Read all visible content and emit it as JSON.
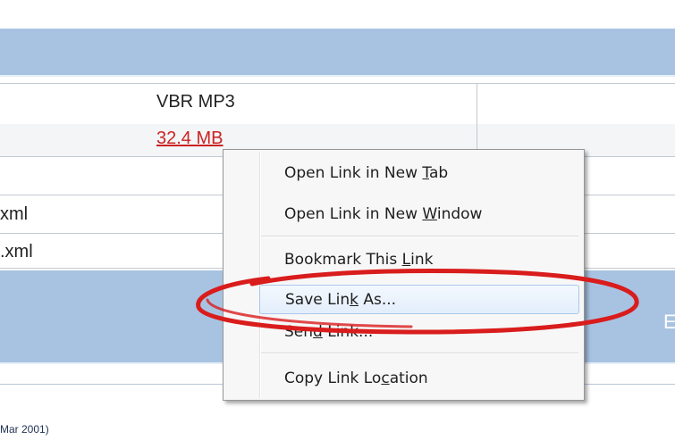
{
  "table": {
    "format_value": "VBR MP3",
    "size_value": "32.4 MB",
    "xml_row_1": "xml",
    "xml_row_2": ".xml",
    "section_char": "E",
    "footer_text": "Mar 2001)"
  },
  "context_menu": {
    "items": [
      {
        "id": "open-tab",
        "label_pre": "Open Link in New ",
        "access_key": "T",
        "label_post": "ab"
      },
      {
        "id": "open-window",
        "label_pre": "Open Link in New ",
        "access_key": "W",
        "label_post": "indow"
      },
      {
        "id": "bookmark",
        "label_pre": "Bookmark This ",
        "access_key": "L",
        "label_post": "ink"
      },
      {
        "id": "save-as",
        "label_pre": "Save Lin",
        "access_key": "k",
        "label_post": " As..."
      },
      {
        "id": "send",
        "label_pre": "Sen",
        "access_key": "d",
        "label_post": " Link..."
      },
      {
        "id": "copy",
        "label_pre": "Copy Link Lo",
        "access_key": "c",
        "label_post": "ation"
      }
    ],
    "highlighted_item": "save-as"
  },
  "colors": {
    "header_bar": "#a8c3e2",
    "size_link": "#cc2222",
    "annotation_ellipse": "#d91c1c"
  }
}
